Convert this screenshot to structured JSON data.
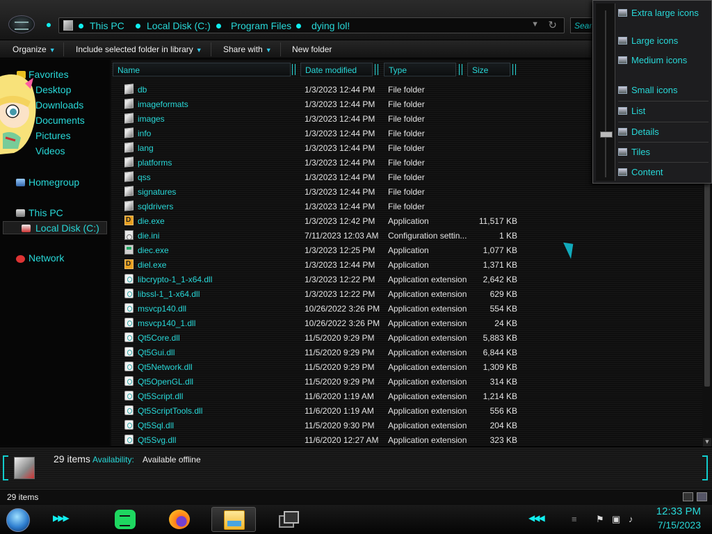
{
  "address": {
    "crumbs": [
      "This PC",
      "Local Disk (C:)",
      "Program Files",
      "dying lol!"
    ],
    "search_placeholder": "Search"
  },
  "toolbar": {
    "organize": "Organize",
    "include_library": "Include selected folder in library",
    "share_with": "Share with",
    "new_folder": "New folder"
  },
  "nav": {
    "favorites": "Favorites",
    "desktop": "Desktop",
    "downloads": "Downloads",
    "documents": "Documents",
    "pictures": "Pictures",
    "videos": "Videos",
    "homegroup": "Homegroup",
    "this_pc": "This PC",
    "local_disk": "Local Disk (C:)",
    "network": "Network"
  },
  "columns": {
    "name": "Name",
    "date": "Date modified",
    "type": "Type",
    "size": "Size"
  },
  "files": [
    {
      "name": "db",
      "date": "1/3/2023 12:44 PM",
      "type": "File folder",
      "size": "",
      "icon": "folder-icon"
    },
    {
      "name": "imageformats",
      "date": "1/3/2023 12:44 PM",
      "type": "File folder",
      "size": "",
      "icon": "folder-icon"
    },
    {
      "name": "images",
      "date": "1/3/2023 12:44 PM",
      "type": "File folder",
      "size": "",
      "icon": "folder-icon"
    },
    {
      "name": "info",
      "date": "1/3/2023 12:44 PM",
      "type": "File folder",
      "size": "",
      "icon": "folder-icon"
    },
    {
      "name": "lang",
      "date": "1/3/2023 12:44 PM",
      "type": "File folder",
      "size": "",
      "icon": "folder-icon"
    },
    {
      "name": "platforms",
      "date": "1/3/2023 12:44 PM",
      "type": "File folder",
      "size": "",
      "icon": "folder-icon"
    },
    {
      "name": "qss",
      "date": "1/3/2023 12:44 PM",
      "type": "File folder",
      "size": "",
      "icon": "folder-icon"
    },
    {
      "name": "signatures",
      "date": "1/3/2023 12:44 PM",
      "type": "File folder",
      "size": "",
      "icon": "folder-icon"
    },
    {
      "name": "sqldrivers",
      "date": "1/3/2023 12:44 PM",
      "type": "File folder",
      "size": "",
      "icon": "folder-icon"
    },
    {
      "name": "die.exe",
      "date": "1/3/2023 12:42 PM",
      "type": "Application",
      "size": "11,517 KB",
      "icon": "die-app-icon"
    },
    {
      "name": "die.ini",
      "date": "7/11/2023 12:03 AM",
      "type": "Configuration settin...",
      "size": "1 KB",
      "icon": "config-file-icon"
    },
    {
      "name": "diec.exe",
      "date": "1/3/2023 12:25 PM",
      "type": "Application",
      "size": "1,077 KB",
      "icon": "console-app-icon"
    },
    {
      "name": "diel.exe",
      "date": "1/3/2023 12:44 PM",
      "type": "Application",
      "size": "1,371 KB",
      "icon": "die-app-icon"
    },
    {
      "name": "libcrypto-1_1-x64.dll",
      "date": "1/3/2023 12:22 PM",
      "type": "Application extension",
      "size": "2,642 KB",
      "icon": "dll-file-icon"
    },
    {
      "name": "libssl-1_1-x64.dll",
      "date": "1/3/2023 12:22 PM",
      "type": "Application extension",
      "size": "629 KB",
      "icon": "dll-file-icon"
    },
    {
      "name": "msvcp140.dll",
      "date": "10/26/2022 3:26 PM",
      "type": "Application extension",
      "size": "554 KB",
      "icon": "dll-file-icon"
    },
    {
      "name": "msvcp140_1.dll",
      "date": "10/26/2022 3:26 PM",
      "type": "Application extension",
      "size": "24 KB",
      "icon": "dll-file-icon"
    },
    {
      "name": "Qt5Core.dll",
      "date": "11/5/2020 9:29 PM",
      "type": "Application extension",
      "size": "5,883 KB",
      "icon": "dll-file-icon"
    },
    {
      "name": "Qt5Gui.dll",
      "date": "11/5/2020 9:29 PM",
      "type": "Application extension",
      "size": "6,844 KB",
      "icon": "dll-file-icon"
    },
    {
      "name": "Qt5Network.dll",
      "date": "11/5/2020 9:29 PM",
      "type": "Application extension",
      "size": "1,309 KB",
      "icon": "dll-file-icon"
    },
    {
      "name": "Qt5OpenGL.dll",
      "date": "11/5/2020 9:29 PM",
      "type": "Application extension",
      "size": "314 KB",
      "icon": "dll-file-icon"
    },
    {
      "name": "Qt5Script.dll",
      "date": "11/6/2020 1:19 AM",
      "type": "Application extension",
      "size": "1,214 KB",
      "icon": "dll-file-icon"
    },
    {
      "name": "Qt5ScriptTools.dll",
      "date": "11/6/2020 1:19 AM",
      "type": "Application extension",
      "size": "556 KB",
      "icon": "dll-file-icon"
    },
    {
      "name": "Qt5Sql.dll",
      "date": "11/5/2020 9:30 PM",
      "type": "Application extension",
      "size": "204 KB",
      "icon": "dll-file-icon"
    },
    {
      "name": "Qt5Svg.dll",
      "date": "11/6/2020 12:27 AM",
      "type": "Application extension",
      "size": "323 KB",
      "icon": "dll-file-icon"
    }
  ],
  "view_menu": {
    "extra_large": "Extra large icons",
    "large": "Large icons",
    "medium": "Medium icons",
    "small": "Small icons",
    "list": "List",
    "details": "Details",
    "tiles": "Tiles",
    "content": "Content"
  },
  "details_pane": {
    "count": "29 items",
    "availability_label": "Availability:",
    "availability_value": "Available offline"
  },
  "status": {
    "count": "29 items"
  },
  "clock": {
    "time": "12:33 PM",
    "date": "7/15/2023"
  },
  "colors": {
    "accent": "#28d8d8",
    "background": "#0a0a0a"
  }
}
